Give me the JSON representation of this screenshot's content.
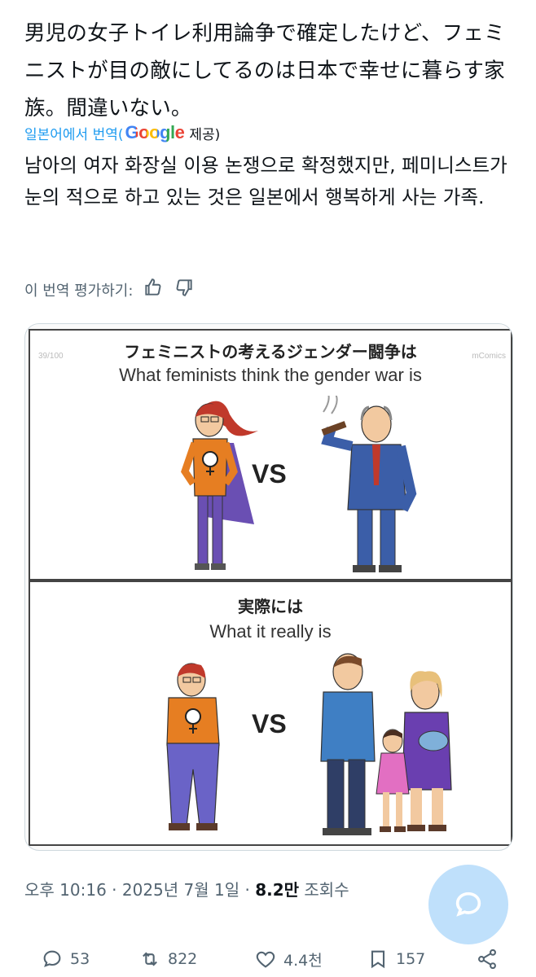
{
  "post": {
    "text": "男児の女子トイレ利用論争で確定したけど、フェミニストが目の敵にしてるのは日本で幸せに暮らす家族。間違いない。",
    "translate_label": "일본어에서 번역(",
    "google_word": "Google",
    "provided": "제공)",
    "translated_text": "남아의 여자 화장실 이용 논쟁으로 확정했지만, 페미니스트가 눈의 적으로 하고 있는 것은 일본에서 행복하게 사는 가족.",
    "rate_label": "이 번역 평가하기:"
  },
  "image": {
    "top_jp": "フェミニストの考えるジェンダー闘争は",
    "top_en": "What feminists think the gender war is",
    "bottom_jp": "実際には",
    "bottom_en": "What it really is",
    "vs1": "VS",
    "vs2": "VS",
    "page_num": "39/100",
    "watermark": "mComics"
  },
  "meta": {
    "time": "오후 10:16 · 2025년 7월 1일 · ",
    "views_count": "8.2만",
    "views_label": " 조회수"
  },
  "actions": {
    "replies": "53",
    "retweets": "822",
    "likes": "4.4천",
    "bookmarks": "157"
  },
  "colors": {
    "accent": "#1d9bf0",
    "muted": "#536471",
    "fab": "#bfe0fb"
  }
}
